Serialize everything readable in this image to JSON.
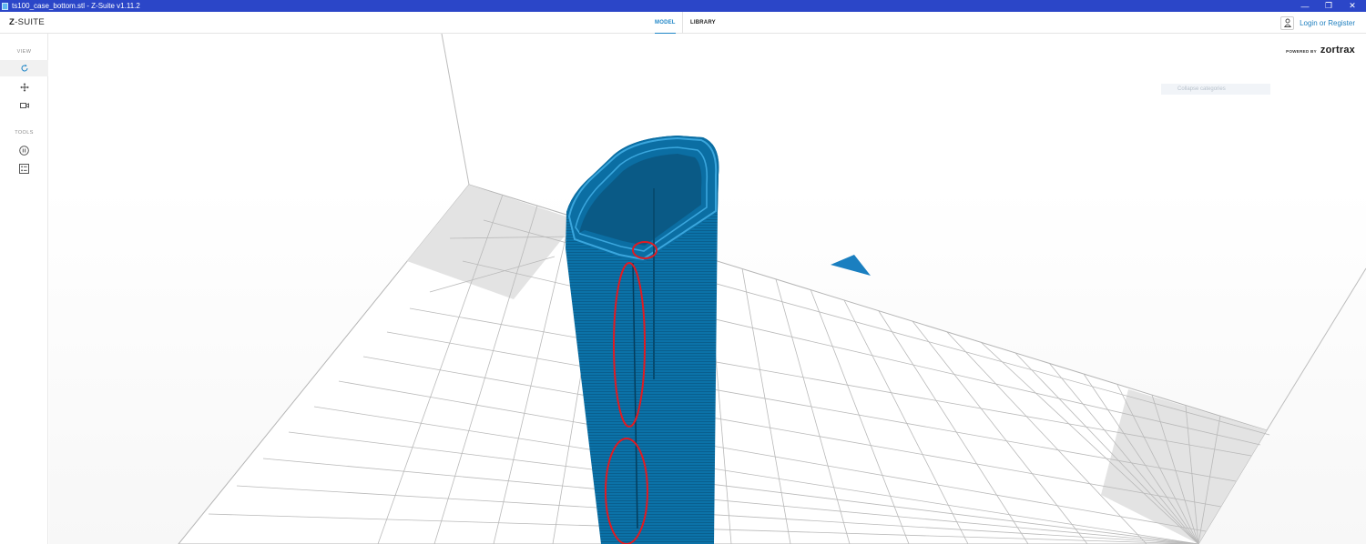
{
  "window": {
    "title": "ts100_case_bottom.stl - Z-Suite v1.11.2",
    "controls": {
      "minimize": "—",
      "restore": "❐",
      "close": "✕"
    }
  },
  "app": {
    "logo_prefix": "Z",
    "logo_suffix": "-SUITE",
    "tabs": [
      {
        "label": "MODEL",
        "active": true
      },
      {
        "label": "LIBRARY",
        "active": false
      }
    ],
    "login_label": "Login or Register"
  },
  "sidebar": {
    "view_heading": "VIEW",
    "tools_heading": "TOOLS",
    "view_items": [
      "rotate-icon",
      "move-icon",
      "camera-icon"
    ],
    "tool_items": [
      "pause-icon",
      "settings-grid-icon"
    ]
  },
  "viewport": {
    "powered_by": "POWERED BY",
    "brand": "zortrax",
    "category_text": "Collapse categories",
    "model_color": "#0a6fa3",
    "model_highlight": "#3aa6dd",
    "annotation_color": "#e01b22",
    "accent": "#1f86c7"
  }
}
